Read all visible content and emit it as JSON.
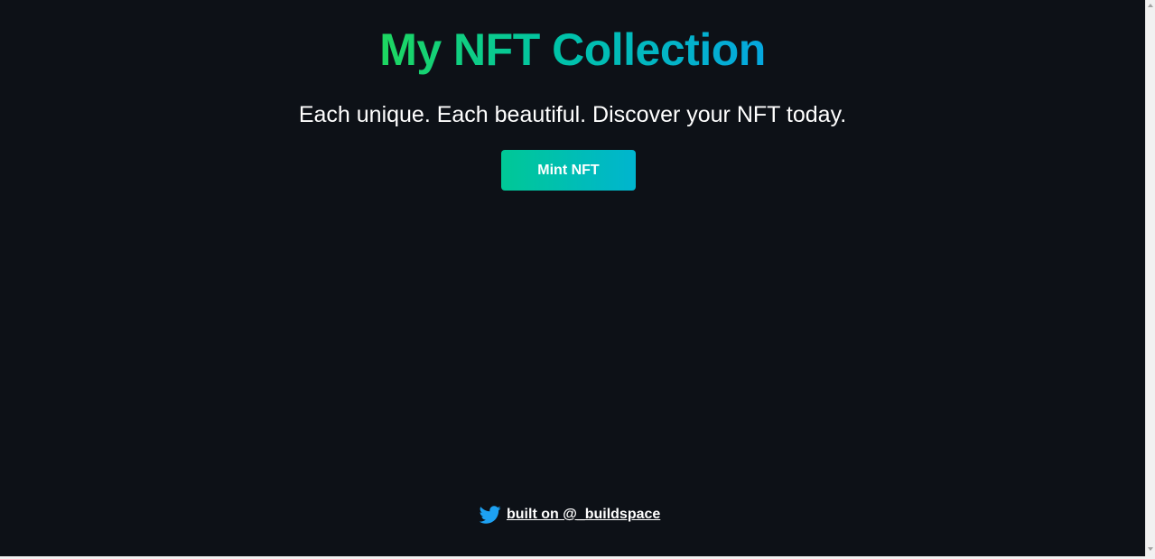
{
  "header": {
    "title": "My NFT Collection",
    "subtitle": "Each unique. Each beautiful. Discover your NFT today."
  },
  "actions": {
    "mint_label": "Mint NFT"
  },
  "footer": {
    "icon": "twitter-icon",
    "link_text": "built on @_buildspace"
  },
  "colors": {
    "background": "#0d1117",
    "title_gradient_start": "#1ed760",
    "title_gradient_end": "#05a7e0",
    "button_gradient_start": "#00c896",
    "button_gradient_end": "#00b5cf",
    "twitter_blue": "#1da1f2",
    "text": "#ffffff"
  }
}
